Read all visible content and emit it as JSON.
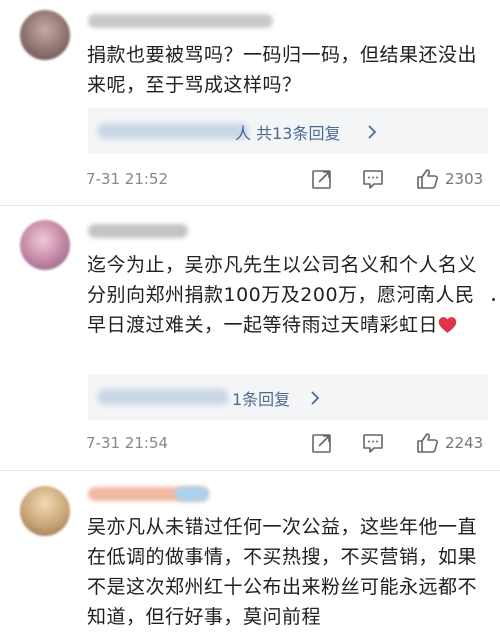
{
  "comments": [
    {
      "text": "捐款也要被骂吗？一码归一码，但结果还没出来呢，至于骂成这样吗？",
      "reply_suffix": "人 共13条回复",
      "date": "7-31 21:52",
      "likes": "2303"
    },
    {
      "text": "迄今为止，吴亦凡先生以公司名义和个人名义分别向郑州捐款100万及200万，愿河南人民早日渡过难关，一起等待雨过天晴彩虹日",
      "reply_suffix": "1条回复",
      "date": "7-31 21:54",
      "likes": "2243"
    },
    {
      "text": "吴亦凡从未错过任何一次公益，这些年他一直在低调的做事情，不买热搜，不买营销，如果不是这次郑州红十公布出来粉丝可能永远都不知道，但行好事，莫问前程"
    }
  ],
  "icons": [
    "share-icon",
    "comment-icon",
    "like-icon",
    "heart-icon",
    "chevron-right-icon"
  ],
  "colors": {
    "reply_link": "#4a6b93",
    "heart": "#e0344a",
    "meta_text": "#888888"
  }
}
